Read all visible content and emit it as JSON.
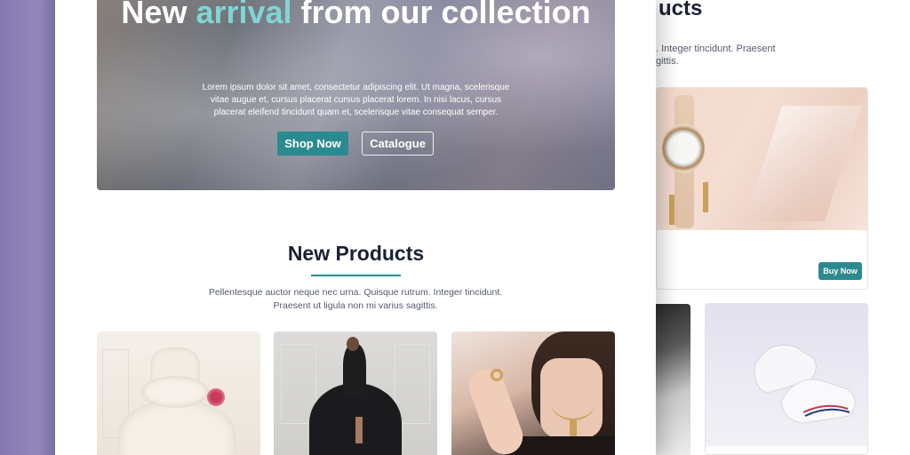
{
  "hero": {
    "title_part1": "New ",
    "title_accent": "arrival",
    "title_part2": " from our collection",
    "text": "Lorem ipsum dolor sit amet, consectetur adipiscing elit. Ut magna, scelerisque vitae augue et, cursus placerat cursus placerat lorem. In nisi lacus, cursus placerat eleifend tincidunt quam et, scelerisque vitae consequat semper.",
    "shop_label": "Shop Now",
    "catalogue_label": "Catalogue"
  },
  "new_products": {
    "title": "New Products",
    "description": "Pellentesque auctor neque nec urna. Quisque rutrum. Integer tincidunt. Praesent ut ligula non mi varius sagittis.",
    "items": [
      {
        "image": "white-dress-photo"
      },
      {
        "image": "black-gown-photo"
      },
      {
        "image": "gold-jewelry-photo"
      }
    ]
  },
  "back_page": {
    "title_fragment": "ucts",
    "desc_fragment": ". Integer tincidunt. Praesent\ngittis.",
    "buy_label": "Buy Now",
    "items": [
      {
        "image": "watch-photo"
      },
      {
        "image": "bag-photo"
      },
      {
        "image": "sneaker-photo"
      }
    ]
  },
  "colors": {
    "accent": "#2b8a8f",
    "accent_text": "#7fd6d3",
    "background": "#8c7fb4"
  }
}
